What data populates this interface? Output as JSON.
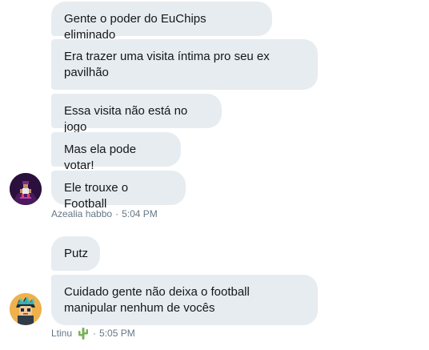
{
  "group1": {
    "messages": [
      "Gente o poder do EuChips eliminado",
      "Era trazer uma visita íntima pro seu ex pavilhão",
      "Essa visita não está no jogo",
      "Mas ela pode votar!",
      "Ele trouxe o Football"
    ],
    "sender": "Azealia habbo",
    "separator": "·",
    "time": "5:04 PM"
  },
  "group2": {
    "messages": [
      "Putz",
      "Cuidado gente não deixa o football manipular nenhum de vocês"
    ],
    "sender": "Ltinu",
    "sender_icon": "cactus-icon",
    "separator": "·",
    "time": "5:05 PM"
  },
  "colors": {
    "bubble_bg": "#e6ecf0",
    "text": "#14171a",
    "meta_text": "#657786"
  }
}
